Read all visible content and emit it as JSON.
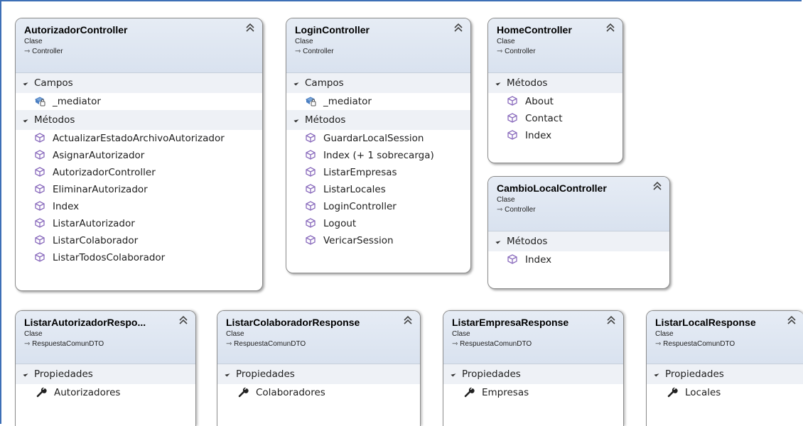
{
  "diagram": {
    "classes": [
      {
        "id": "autorizador",
        "name": "AutorizadorController",
        "kind": "Clase",
        "base": "Controller",
        "sections": [
          {
            "title": "Campos",
            "members": [
              "_mediator"
            ]
          },
          {
            "title": "Métodos",
            "members": [
              "ActualizarEstadoArchivoAutorizador",
              "AsignarAutorizador",
              "AutorizadorController",
              "EliminarAutorizador",
              "Index",
              "ListarAutorizador",
              "ListarColaborador",
              "ListarTodosColaborador"
            ]
          }
        ]
      },
      {
        "id": "login",
        "name": "LoginController",
        "kind": "Clase",
        "base": "Controller",
        "sections": [
          {
            "title": "Campos",
            "members": [
              "_mediator"
            ]
          },
          {
            "title": "Métodos",
            "members": [
              "GuardarLocalSession",
              "Index (+ 1 sobrecarga)",
              "ListarEmpresas",
              "ListarLocales",
              "LoginController",
              "Logout",
              "VericarSession"
            ]
          }
        ]
      },
      {
        "id": "home",
        "name": "HomeController",
        "kind": "Clase",
        "base": "Controller",
        "sections": [
          {
            "title": "Métodos",
            "members": [
              "About",
              "Contact",
              "Index"
            ]
          }
        ]
      },
      {
        "id": "cambiolocal",
        "name": "CambioLocalController",
        "kind": "Clase",
        "base": "Controller",
        "sections": [
          {
            "title": "Métodos",
            "members": [
              "Index"
            ]
          }
        ]
      },
      {
        "id": "listarautorizador",
        "name": "ListarAutorizadorRespo...",
        "kind": "Clase",
        "base": "RespuestaComunDTO",
        "sections": [
          {
            "title": "Propiedades",
            "members": [
              "Autorizadores"
            ]
          }
        ]
      },
      {
        "id": "listarcolaborador",
        "name": "ListarColaboradorResponse",
        "kind": "Clase",
        "base": "RespuestaComunDTO",
        "sections": [
          {
            "title": "Propiedades",
            "members": [
              "Colaboradores"
            ]
          }
        ]
      },
      {
        "id": "listarempresa",
        "name": "ListarEmpresaResponse",
        "kind": "Clase",
        "base": "RespuestaComunDTO",
        "sections": [
          {
            "title": "Propiedades",
            "members": [
              "Empresas"
            ]
          }
        ]
      },
      {
        "id": "listarlocal",
        "name": "ListarLocalResponse",
        "kind": "Clase",
        "base": "RespuestaComunDTO",
        "sections": [
          {
            "title": "Propiedades",
            "members": [
              "Locales"
            ]
          }
        ]
      }
    ]
  },
  "colors": {
    "header": "#dde5f0",
    "section": "#eef1f6",
    "method_icon": "#8a6bbd",
    "field_icon": "#4b7fc2",
    "border": "#8b8b8b"
  },
  "icons": {
    "collapse": "double-chevron-up-icon",
    "section_toggle": "triangle-expanded-icon",
    "method": "method-cube-icon",
    "field": "private-field-icon",
    "property": "wrench-property-icon",
    "inherit": "inheritance-arrow-icon"
  }
}
